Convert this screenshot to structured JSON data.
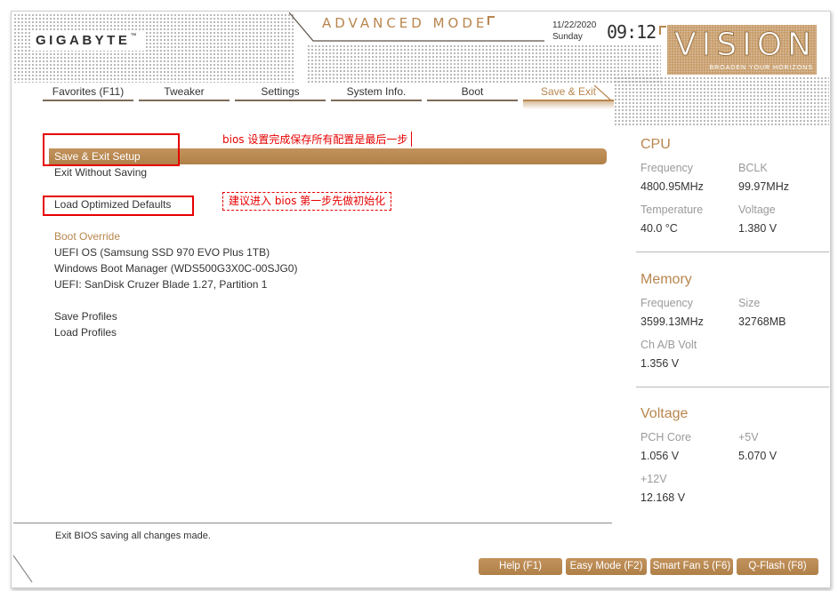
{
  "theme": {
    "accent": "#b8864e",
    "text": "#333333",
    "label": "#9a9a9a",
    "mark": "#e60000"
  },
  "header": {
    "brand": "GIGABYTE",
    "brand_tm": "™",
    "mode_title": "ADVANCED MODE",
    "date": "11/22/2020",
    "day": "Sunday",
    "time": "09:12",
    "logo": "VISION",
    "logo_tagline": "BROADEN YOUR HORIZONS"
  },
  "tabs": [
    {
      "label": "Favorites (F11)",
      "active": false
    },
    {
      "label": "Tweaker",
      "active": false
    },
    {
      "label": "Settings",
      "active": false
    },
    {
      "label": "System Info.",
      "active": false
    },
    {
      "label": "Boot",
      "active": false
    },
    {
      "label": "Save & Exit",
      "active": true
    }
  ],
  "menu": {
    "actions": [
      {
        "label": "Save & Exit Setup",
        "selected": true
      },
      {
        "label": "Exit Without Saving",
        "selected": false
      },
      {
        "label": "Load Optimized Defaults",
        "selected": false
      }
    ],
    "boot_override": {
      "title": "Boot Override",
      "devices": [
        "UEFI OS (Samsung SSD 970 EVO Plus 1TB)",
        "Windows Boot Manager (WDS500G3X0C-00SJG0)",
        "UEFI: SanDisk Cruzer Blade 1.27, Partition 1"
      ]
    },
    "profiles": [
      "Save Profiles",
      "Load Profiles"
    ]
  },
  "annotations": {
    "save_note": "bios 设置完成保存所有配置是最后一步",
    "defaults_note": "建议进入 bios 第一步先做初始化"
  },
  "hardware_monitor": [
    {
      "title": "CPU",
      "fields": [
        {
          "label": "Frequency",
          "value": "4800.95MHz"
        },
        {
          "label": "BCLK",
          "value": "99.97MHz"
        },
        {
          "label": "Temperature",
          "value": "40.0 °C"
        },
        {
          "label": "Voltage",
          "value": "1.380 V"
        }
      ]
    },
    {
      "title": "Memory",
      "fields": [
        {
          "label": "Frequency",
          "value": "3599.13MHz"
        },
        {
          "label": "Size",
          "value": "32768MB"
        },
        {
          "label": "Ch A/B Volt",
          "value": "1.356 V"
        }
      ]
    },
    {
      "title": "Voltage",
      "fields": [
        {
          "label": "PCH Core",
          "value": "1.056 V"
        },
        {
          "label": "+5V",
          "value": "5.070 V"
        },
        {
          "label": "+12V",
          "value": "12.168 V"
        }
      ]
    }
  ],
  "help_text": "Exit BIOS saving all changes made.",
  "footer_buttons": [
    {
      "label": "Help (F1)"
    },
    {
      "label": "Easy Mode (F2)"
    },
    {
      "label": "Smart Fan 5 (F6)"
    },
    {
      "label": "Q-Flash (F8)"
    }
  ]
}
